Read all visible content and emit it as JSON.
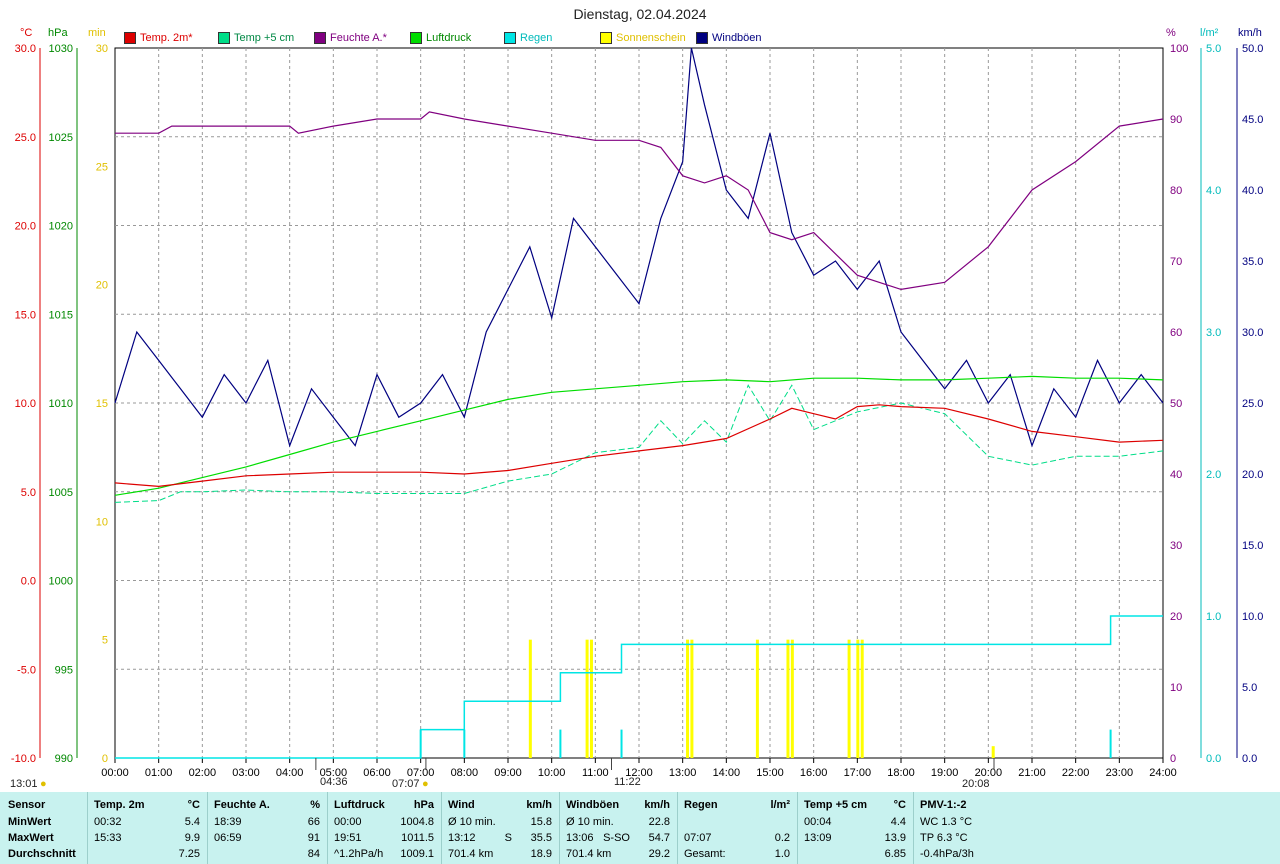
{
  "title": "Dienstag, 02.04.2024",
  "axes": {
    "unit_temp": "°C",
    "unit_hpa": "hPa",
    "unit_min": "min",
    "unit_pct": "%",
    "unit_lm2": "l/m²",
    "unit_kmh": "km/h",
    "temp_ticks": [
      "30.0",
      "25.0",
      "20.0",
      "15.0",
      "10.0",
      "5.0",
      "0.0",
      "-5.0",
      "-10.0"
    ],
    "hpa_ticks": [
      "1030",
      "1025",
      "1020",
      "1015",
      "1010",
      "1005",
      "1000",
      "995",
      "990"
    ],
    "min_ticks": [
      "30",
      "25",
      "20",
      "15",
      "10",
      "5",
      "0"
    ],
    "pct_ticks": [
      "100",
      "90",
      "80",
      "70",
      "60",
      "50",
      "40",
      "30",
      "20",
      "10",
      "0"
    ],
    "rain_ticks": [
      "5.0",
      "4.0",
      "3.0",
      "2.0",
      "1.0",
      "0.0"
    ],
    "kmh_ticks": [
      "50.0",
      "45.0",
      "40.0",
      "35.0",
      "30.0",
      "25.0",
      "20.0",
      "15.0",
      "10.0",
      "5.0",
      "0.0"
    ],
    "x_ticks": [
      "00:00",
      "01:00",
      "02:00",
      "03:00",
      "04:00",
      "05:00",
      "06:00",
      "07:00",
      "08:00",
      "09:00",
      "10:00",
      "11:00",
      "12:00",
      "13:00",
      "14:00",
      "15:00",
      "16:00",
      "17:00",
      "18:00",
      "19:00",
      "20:00",
      "21:00",
      "22:00",
      "23:00",
      "24:00"
    ]
  },
  "legend": [
    {
      "label": "Temp. 2m*",
      "color": "#dd0000",
      "text_color": "#dd0000"
    },
    {
      "label": "Temp +5 cm",
      "color": "#00dd88",
      "text_color": "#008844"
    },
    {
      "label": "Feuchte A.*",
      "color": "#800080",
      "text_color": "#800080"
    },
    {
      "label": "Luftdruck",
      "color": "#00dd00",
      "text_color": "#008800"
    },
    {
      "label": "Regen",
      "color": "#00e5e5",
      "text_color": "#00bbbb"
    },
    {
      "label": "Sonnenschein",
      "color": "#ffff00",
      "text_color": "#e0c000"
    },
    {
      "label": "Windböen",
      "color": "#000080",
      "text_color": "#000080"
    }
  ],
  "markers": {
    "left_time": "13:01",
    "sunrise": "04:36",
    "sunup": "07:07",
    "noon": "11:22",
    "sunset": "20:08"
  },
  "chart_data": {
    "type": "line",
    "title": "Dienstag, 02.04.2024",
    "x_unit": "hours",
    "xlim": [
      0,
      24
    ],
    "series": [
      {
        "name": "Temp. 2m*",
        "unit": "°C",
        "color": "#dd0000",
        "x": [
          0,
          1,
          2,
          3,
          4,
          5,
          6,
          7,
          8,
          9,
          10,
          11,
          12,
          13,
          14,
          15,
          15.5,
          16,
          16.5,
          17,
          17.5,
          18,
          19,
          20,
          21,
          22,
          23,
          24
        ],
        "y": [
          5.5,
          5.3,
          5.6,
          5.9,
          6.0,
          6.1,
          6.1,
          6.1,
          6.0,
          6.2,
          6.6,
          7.0,
          7.3,
          7.6,
          8.0,
          9.1,
          9.7,
          9.4,
          9.1,
          9.8,
          9.9,
          9.8,
          9.7,
          9.1,
          8.4,
          8.1,
          7.8,
          7.9
        ]
      },
      {
        "name": "Temp +5 cm",
        "unit": "°C",
        "color": "#00dd88",
        "x": [
          0,
          1,
          1.5,
          2,
          3,
          4,
          5,
          6,
          7,
          8,
          9,
          10,
          11,
          12,
          12.5,
          13,
          13.5,
          14,
          14.5,
          15,
          15.5,
          16,
          17,
          18,
          19,
          20,
          21,
          22,
          23,
          24
        ],
        "y": [
          4.4,
          4.5,
          5.0,
          5.0,
          5.1,
          5.0,
          5.0,
          4.9,
          4.9,
          4.9,
          5.6,
          6.0,
          7.2,
          7.5,
          9.0,
          7.7,
          9.0,
          7.8,
          11.0,
          9.0,
          11.0,
          8.5,
          9.5,
          10.0,
          9.4,
          7.0,
          6.5,
          7.0,
          7.0,
          7.3
        ]
      },
      {
        "name": "Feuchte A.*",
        "unit": "%",
        "color": "#800080",
        "x": [
          0,
          1,
          1.3,
          2,
          3,
          4,
          4.2,
          5,
          6,
          7,
          7.2,
          8,
          9,
          10,
          11,
          12,
          12.5,
          13,
          13.5,
          14,
          14.5,
          15,
          15.5,
          16,
          17,
          18,
          19,
          20,
          21,
          22,
          23,
          24
        ],
        "y": [
          88,
          88,
          89,
          89,
          89,
          89,
          88,
          89,
          90,
          90,
          91,
          90,
          89,
          88,
          87,
          87,
          86,
          82,
          81,
          82,
          80,
          74,
          73,
          74,
          68,
          66,
          67,
          72,
          80,
          84,
          89,
          90
        ]
      },
      {
        "name": "Luftdruck",
        "unit": "hPa",
        "color": "#00dd00",
        "x": [
          0,
          1,
          2,
          3,
          4,
          5,
          6,
          7,
          8,
          9,
          10,
          11,
          12,
          13,
          14,
          15,
          16,
          17,
          18,
          19,
          20,
          21,
          22,
          23,
          24
        ],
        "y": [
          1004.8,
          1005.2,
          1005.8,
          1006.4,
          1007.1,
          1007.8,
          1008.4,
          1009.0,
          1009.6,
          1010.2,
          1010.6,
          1010.8,
          1011.0,
          1011.2,
          1011.3,
          1011.2,
          1011.4,
          1011.4,
          1011.3,
          1011.3,
          1011.4,
          1011.5,
          1011.4,
          1011.4,
          1011.3
        ]
      },
      {
        "name": "Regen",
        "unit": "l/m²",
        "color": "#00e5e5",
        "x": [
          0,
          7.0,
          7.0,
          8.0,
          8.0,
          10.2,
          10.2,
          11.6,
          11.6,
          22.8,
          22.8,
          24
        ],
        "y": [
          0,
          0,
          0.2,
          0.2,
          0.4,
          0.4,
          0.6,
          0.6,
          0.8,
          0.8,
          1.0,
          1.0
        ]
      },
      {
        "name": "Windböen",
        "unit": "km/h",
        "color": "#000080",
        "note": "gusts fluctuating 15–50 km/h",
        "x": [
          0,
          0.5,
          1,
          1.5,
          2,
          2.5,
          3,
          3.5,
          4,
          4.5,
          5,
          5.5,
          6,
          6.5,
          7,
          7.5,
          8,
          8.5,
          9,
          9.5,
          10,
          10.5,
          11,
          11.5,
          12,
          12.5,
          13,
          13.2,
          13.5,
          14,
          14.5,
          15,
          15.5,
          16,
          16.5,
          17,
          17.5,
          18,
          18.5,
          19,
          19.5,
          20,
          20.5,
          21,
          21.5,
          22,
          22.5,
          23,
          23.5,
          24
        ],
        "y": [
          25,
          30,
          28,
          26,
          24,
          27,
          25,
          28,
          22,
          26,
          24,
          22,
          27,
          24,
          25,
          27,
          24,
          30,
          33,
          36,
          31,
          38,
          36,
          34,
          32,
          38,
          42,
          50,
          46,
          40,
          38,
          44,
          37,
          34,
          35,
          33,
          35,
          30,
          28,
          26,
          28,
          25,
          27,
          22,
          26,
          24,
          28,
          25,
          27,
          25
        ]
      }
    ],
    "sunshine": {
      "unit": "min",
      "color": "#ffff00",
      "x": [
        9.5,
        10.8,
        10.9,
        13.1,
        13.2,
        14.7,
        15.4,
        15.5,
        16.8,
        17.0,
        17.1,
        20.1
      ],
      "y": [
        5,
        5,
        5,
        5,
        5,
        5,
        5,
        5,
        5,
        5,
        5,
        0.5
      ]
    },
    "rain_pulses": {
      "x": [
        7.0,
        8.0,
        10.2,
        11.6,
        22.8
      ],
      "y": [
        0.2,
        0.2,
        0.2,
        0.2,
        0.2
      ]
    }
  },
  "footer": {
    "rows": [
      "MinWert",
      "MaxWert",
      "Durchschnitt"
    ],
    "sensor_label": "Sensor",
    "columns": [
      {
        "head": "Temp. 2m",
        "unit": "°C",
        "min_time": "00:32",
        "min": "5.4",
        "max_time": "15:33",
        "max": "9.9",
        "avg": "7.25"
      },
      {
        "head": "Feuchte A.",
        "unit": "%",
        "min_time": "18:39",
        "min": "66",
        "max_time": "06:59",
        "max": "91",
        "avg": "84"
      },
      {
        "head": "Luftdruck",
        "unit": "hPa",
        "min_time": "00:00",
        "min": "1004.8",
        "max_time": "19:51",
        "max": "1011.5",
        "avg_label": "^1.2hPa/h",
        "avg": "1009.1"
      },
      {
        "head": "Wind",
        "unit": "km/h",
        "min_time": "Ø 10 min.",
        "min": "15.8",
        "max_time": "13:12",
        "max_dir": "S",
        "max": "35.5",
        "avg_label": "701.4 km",
        "avg": "18.9"
      },
      {
        "head": "Windböen",
        "unit": "km/h",
        "min_time": "Ø 10 min.",
        "min": "22.8",
        "max_time": "13:06",
        "max_dir": "S-SO",
        "max": "54.7",
        "avg_label": "701.4 km",
        "avg": "29.2"
      },
      {
        "head": "Regen",
        "unit": "l/m²",
        "min_time": "",
        "min": "",
        "max_time": "07:07",
        "max": "0.2",
        "avg_label": "Gesamt:",
        "avg": "1.0"
      },
      {
        "head": "Temp +5 cm",
        "unit": "°C",
        "min_time": "00:04",
        "min": "4.4",
        "max_time": "13:09",
        "max": "13.9",
        "avg": "6.85"
      },
      {
        "head": "PMV-1:-2",
        "unit": "",
        "min_time": "WC 1.3 °C",
        "min": "",
        "max_time": "TP 6.3 °C",
        "max": "",
        "avg_label": "-0.4hPa/3h",
        "avg": ""
      }
    ]
  }
}
